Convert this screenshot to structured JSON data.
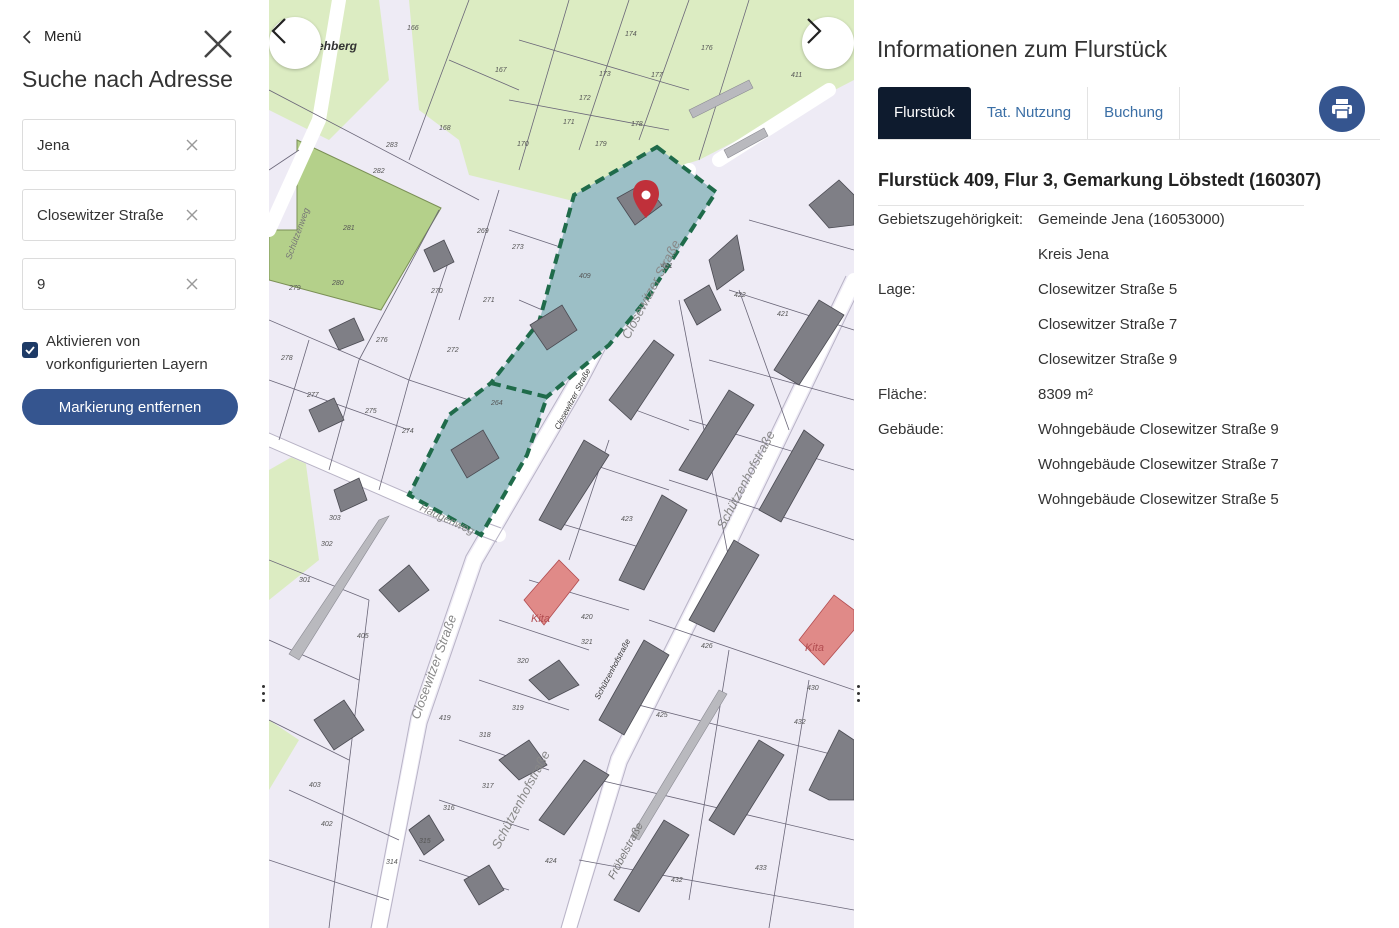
{
  "sidebar": {
    "menu_label": "Menü",
    "title": "Suche nach Adresse",
    "fields": [
      {
        "value": "Jena"
      },
      {
        "value": "Closewitzer Straße"
      },
      {
        "value": "9"
      }
    ],
    "checkbox_label": "Aktivieren von vorkonfigurierten Layern",
    "checkbox_checked": true,
    "remove_button": "Markierung entfernen"
  },
  "map": {
    "labels": [
      "ehberg",
      "166",
      "167",
      "174",
      "176",
      "173",
      "177",
      "172",
      "171",
      "170",
      "168",
      "179",
      "178",
      "411",
      "283",
      "282",
      "281",
      "280",
      "269",
      "270",
      "271",
      "272",
      "273",
      "274",
      "275",
      "276",
      "277",
      "278",
      "279",
      "264",
      "409",
      "401",
      "422",
      "421",
      "420",
      "423",
      "424",
      "425",
      "426",
      "430",
      "432",
      "433",
      "405",
      "402",
      "403",
      "419",
      "318",
      "317",
      "316",
      "315",
      "314",
      "319",
      "320",
      "321",
      "303",
      "302",
      "301",
      "Closewitzer Straße",
      "Schützenhofstraße",
      "Schützenweg",
      "Haugenweg",
      "Kita",
      "Fröbelstraße"
    ],
    "label_color": "#555555",
    "marker_color": "#c0303a",
    "parcel_fill": "#9cbfc6",
    "parcel_border": "#1f6b4a"
  },
  "info": {
    "title": "Informationen zum Flurstück",
    "tabs": [
      "Flurstück",
      "Tat. Nutzung",
      "Buchung"
    ],
    "active_tab": "Flurstück",
    "parcel_heading": "Flurstück 409, Flur 3, Gemarkung Löbstedt (160307)",
    "rows": [
      {
        "key": "Gebietszugehörigkeit:",
        "value": "Gemeinde Jena (16053000)"
      },
      {
        "key": "",
        "value": "Kreis Jena"
      },
      {
        "key": "Lage:",
        "value": "Closewitzer Straße 5"
      },
      {
        "key": "",
        "value": "Closewitzer Straße 7"
      },
      {
        "key": "",
        "value": "Closewitzer Straße 9"
      },
      {
        "key": "Fläche:",
        "value": "8309 m²"
      },
      {
        "key": "Gebäude:",
        "value": "Wohngebäude Closewitzer Straße 9"
      },
      {
        "key": "",
        "value": "Wohngebäude Closewitzer Straße 7"
      },
      {
        "key": "",
        "value": "Wohngebäude Closewitzer Straße 5"
      }
    ]
  },
  "colors": {
    "accent": "#35558f",
    "tab_active_bg": "#0e1b2e",
    "tab_link": "#3a6ea5"
  }
}
